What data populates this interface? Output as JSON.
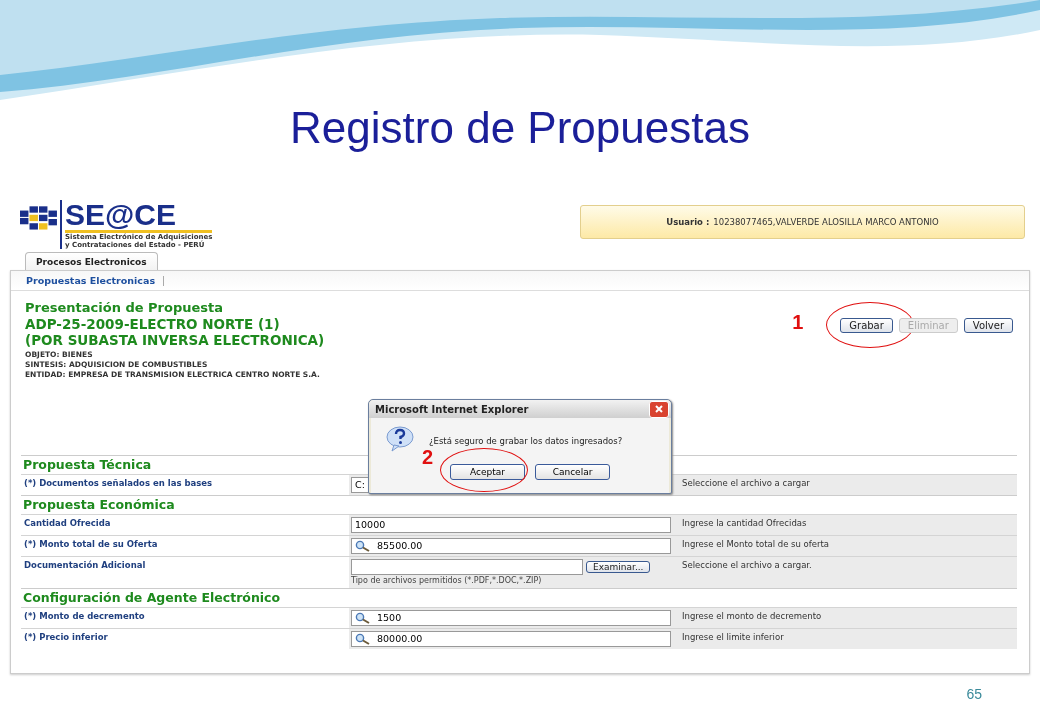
{
  "slide": {
    "title": "Registro de Propuestas",
    "page_number": "65"
  },
  "app": {
    "logo": {
      "name": "SE@CE",
      "subtitle_lines": [
        "Sistema Electrónico de Adquisiciones",
        "y Contrataciones del Estado - PERÚ"
      ]
    },
    "user": {
      "label": "Usuario :",
      "value": "10238077465,VALVERDE ALOSILLA MARCO ANTONIO"
    },
    "tabs": [
      {
        "label": "Procesos Electronicos",
        "selected": true
      }
    ],
    "subnav": [
      {
        "label": "Propuestas Electronicas"
      }
    ],
    "header": {
      "title": "Presentación de Propuesta",
      "process_lines": [
        "ADP-25-2009-ELECTRO NORTE (1)",
        "(POR SUBASTA INVERSA ELECTRONICA)"
      ],
      "details": [
        "OBJETO: BIENES",
        "SINTESIS: ADQUISICION DE COMBUSTIBLES",
        "ENTIDAD: EMPRESA DE TRANSMISION ELECTRICA CENTRO NORTE S.A."
      ]
    },
    "actions": [
      {
        "label": "Grabar",
        "disabled": false,
        "annotation": "1"
      },
      {
        "label": "Eliminar",
        "disabled": true
      },
      {
        "label": "Volver",
        "disabled": false
      }
    ],
    "sections": [
      {
        "title": "Propuesta Técnica",
        "rows": [
          {
            "kind": "file",
            "label": "(*) Documentos señalados en las bases",
            "value": "C:",
            "hint": "Seleccione el archivo a cargar"
          }
        ]
      },
      {
        "title": "Propuesta Económica",
        "rows": [
          {
            "kind": "text",
            "label": "Cantidad Ofrecida",
            "value": "10000",
            "hint": "Ingrese la cantidad Ofrecidas"
          },
          {
            "kind": "lookup",
            "label": "(*) Monto total de su Oferta",
            "value": "85500.00",
            "hint": "Ingrese el Monto total de su oferta"
          },
          {
            "kind": "file",
            "label": "Documentación Adicional",
            "button": "Examinar...",
            "note": "Tipo de archivos permitidos (*.PDF,*.DOC,*.ZIP)",
            "hint": "Seleccione el archivo a cargar."
          }
        ]
      },
      {
        "title": "Configuración de Agente Electrónico",
        "rows": [
          {
            "kind": "lookup",
            "label": "(*) Monto de decremento",
            "value": "1500",
            "hint": "Ingrese el monto de decremento"
          },
          {
            "kind": "lookup",
            "label": "(*) Precio inferior",
            "value": "80000.00",
            "hint": "Ingrese el limite inferior"
          }
        ]
      }
    ],
    "dialog": {
      "title": "Microsoft Internet Explorer",
      "message": "¿Está seguro de grabar los datos ingresados?",
      "buttons": [
        {
          "label": "Aceptar",
          "annotation": "2"
        },
        {
          "label": "Cancelar"
        }
      ]
    }
  }
}
